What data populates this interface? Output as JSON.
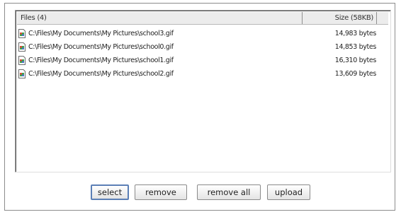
{
  "file_list": {
    "columns": {
      "files": "Files (4)",
      "size": "Size (58KB)"
    },
    "rows": [
      {
        "name": "C:\\Files\\My Documents\\My Pictures\\school3.gif",
        "size": "14,983 bytes",
        "icon": "gif-file-icon"
      },
      {
        "name": "C:\\Files\\My Documents\\My Pictures\\school0.gif",
        "size": "14,853 bytes",
        "icon": "gif-file-icon"
      },
      {
        "name": "C:\\Files\\My Documents\\My Pictures\\school1.gif",
        "size": "16,310 bytes",
        "icon": "gif-file-icon"
      },
      {
        "name": "C:\\Files\\My Documents\\My Pictures\\school2.gif",
        "size": "13,609 bytes",
        "icon": "gif-file-icon"
      }
    ]
  },
  "buttons": {
    "select": "select",
    "remove": "remove",
    "remove_all": "remove all",
    "upload": "upload"
  },
  "colors": {
    "focus_border": "#5b7fb6",
    "header_bg": "#ececec"
  }
}
